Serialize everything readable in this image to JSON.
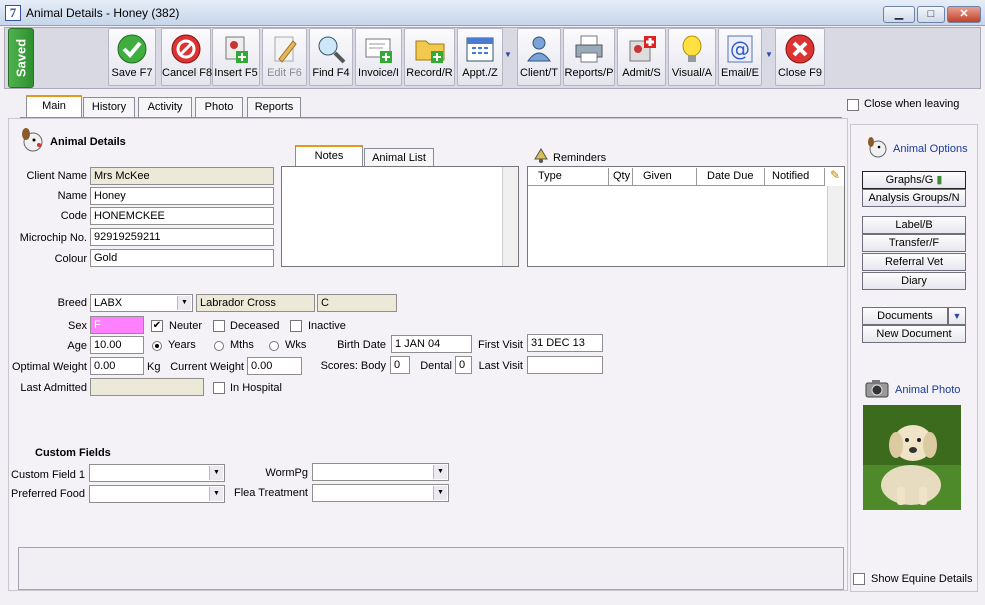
{
  "window": {
    "title": "Animal Details - Honey (382)",
    "app_icon": "7"
  },
  "colors": {
    "sex_field": "#ff80ff",
    "saved_badge": "#3fa53f",
    "accent_tab": "#e39a1b",
    "link": "#1a3c9b"
  },
  "saved_label": "Saved",
  "toolbar": [
    {
      "key": "save",
      "label": "Save F7",
      "icon": "green-check-icon"
    },
    {
      "key": "cancel",
      "label": "Cancel F8",
      "icon": "no-entry-icon"
    },
    {
      "key": "insert",
      "label": "Insert F5",
      "icon": "insert-animal-icon"
    },
    {
      "key": "edit",
      "label": "Edit F6",
      "icon": "edit-pencil-icon",
      "disabled": true
    },
    {
      "key": "find",
      "label": "Find F4",
      "icon": "magnifier-icon"
    },
    {
      "key": "invoice",
      "label": "Invoice/I",
      "icon": "invoice-add-icon"
    },
    {
      "key": "record",
      "label": "Record/R",
      "icon": "folder-add-icon"
    },
    {
      "key": "appt",
      "label": "Appt./Z",
      "icon": "calendar-icon"
    },
    {
      "key": "client",
      "label": "Client/T",
      "icon": "person-icon"
    },
    {
      "key": "reports",
      "label": "Reports/P",
      "icon": "printer-icon"
    },
    {
      "key": "admit",
      "label": "Admit/S",
      "icon": "hospital-icon"
    },
    {
      "key": "visual",
      "label": "Visual/A",
      "icon": "lightbulb-icon"
    },
    {
      "key": "email",
      "label": "Email/E",
      "icon": "at-sign-icon"
    },
    {
      "key": "close",
      "label": "Close F9",
      "icon": "close-x-icon"
    }
  ],
  "tabs": [
    "Main",
    "History",
    "Activity",
    "Photo",
    "Reports"
  ],
  "close_when_leaving": "Close when leaving",
  "animal_details": {
    "heading": "Animal Details",
    "client_name_label": "Client Name",
    "client_name": "Mrs McKee",
    "name_label": "Name",
    "name": "Honey",
    "code_label": "Code",
    "code": "HONEMCKEE",
    "microchip_label": "Microchip No.",
    "microchip": "92919259211",
    "colour_label": "Colour",
    "colour": "Gold"
  },
  "notes_tabs": [
    "Notes",
    "Animal List"
  ],
  "reminders": {
    "title": "Reminders",
    "columns": [
      "Type",
      "Qty",
      "Given",
      "Date Due",
      "Notified"
    ]
  },
  "details": {
    "breed_label": "Breed",
    "breed_code": "LABX",
    "breed_name": "Labrador Cross",
    "breed_extra": "C",
    "sex_label": "Sex",
    "sex": "F",
    "neuter": "Neuter",
    "neuter_checked": true,
    "deceased": "Deceased",
    "inactive": "Inactive",
    "age_label": "Age",
    "age": "10.00",
    "years": "Years",
    "mths": "Mths",
    "wks": "Wks",
    "birth_date_label": "Birth Date",
    "birth_date": "1 JAN 04",
    "first_visit_label": "First Visit",
    "first_visit": "31 DEC 13",
    "optimal_weight_label": "Optimal Weight",
    "optimal_weight": "0.00",
    "kg": "Kg",
    "current_weight_label": "Current Weight",
    "current_weight": "0.00",
    "scores_label": "Scores: Body",
    "body_score": "0",
    "dental_label": "Dental",
    "dental_score": "0",
    "last_visit_label": "Last Visit",
    "last_visit": "",
    "last_admitted_label": "Last Admitted",
    "last_admitted": "",
    "in_hospital": "In Hospital"
  },
  "custom_fields": {
    "heading": "Custom Fields",
    "cf1_label": "Custom Field 1",
    "cf1": "",
    "food_label": "Preferred Food",
    "food": "",
    "wormpg_label": "WormPg",
    "wormpg": "",
    "flea_label": "Flea Treatment",
    "flea": ""
  },
  "sidebar": {
    "options_title": "Animal Options",
    "graphs": "Graphs/G",
    "analysis": "Analysis Groups/N",
    "label": "Label/B",
    "transfer": "Transfer/F",
    "referral": "Referral Vet",
    "diary": "Diary",
    "documents": "Documents",
    "new_document": "New Document",
    "photo_title": "Animal Photo",
    "show_equine": "Show Equine Details"
  }
}
